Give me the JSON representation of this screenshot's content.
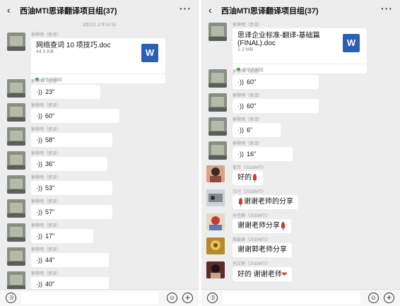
{
  "chat": {
    "title": "西油MTI思译翻译项目组(37)",
    "back_icon": "‹",
    "more_icon": "···"
  },
  "left": {
    "timestamp": "3月2日 上午10:15",
    "file": {
      "sender": "郭舜明（思译）",
      "name": "网络查词 10 项技巧.doc",
      "size": "44.5 KB",
      "icon_label": "W",
      "source": "微信电脑版"
    },
    "voices": [
      {
        "sender": "郭舜明（思译）",
        "duration": "23\""
      },
      {
        "sender": "郭舜明（思译）",
        "duration": "60\""
      },
      {
        "sender": "郭舜明（思译）",
        "duration": "58\""
      },
      {
        "sender": "郭舜明（思译）",
        "duration": "36\""
      },
      {
        "sender": "郭舜明（思译）",
        "duration": "53\""
      },
      {
        "sender": "郭舜明（思译）",
        "duration": "57\""
      },
      {
        "sender": "郭舜明（思译）",
        "duration": "17\""
      },
      {
        "sender": "郭舜明（思译）",
        "duration": "44\""
      },
      {
        "sender": "郭舜明（思译）",
        "duration": "40\""
      }
    ]
  },
  "right": {
    "file": {
      "sender": "郭舜明（思译）",
      "name": "思译企业标准-翻译-基础篇(FINAL).doc",
      "size": "1.3 MB",
      "icon_label": "W",
      "source": "微信电脑版"
    },
    "voices": [
      {
        "sender": "郭舜明（思译）",
        "duration": "60\""
      },
      {
        "sender": "郭舜明（思译）",
        "duration": "60\""
      },
      {
        "sender": "郭舜明（思译）",
        "duration": "6\""
      },
      {
        "sender": "郭舜明（思译）",
        "duration": "16\""
      }
    ],
    "texts": [
      {
        "sender": "邹芳（2018MTI）",
        "text": "好的",
        "emoji": "rose"
      },
      {
        "sender": "汪兴（2018MTI）",
        "text": "谢谢老师的分享",
        "emoji": "rose-prefix"
      },
      {
        "sender": "孙佳醇（2018MTI）",
        "text": "谢谢老师分享",
        "emoji": "rose"
      },
      {
        "sender": "周最颖（2018MTI）",
        "text": "谢谢郭老师分享",
        "emoji": ""
      },
      {
        "sender": "孙文婷（2018MTI）",
        "text": "好的 谢谢老师",
        "emoji": "heart"
      }
    ]
  },
  "input": {
    "voice_icon": "voice-toggle-icon",
    "emoji_icon": "emoji-icon",
    "plus_icon": "plus-icon"
  },
  "colors": {
    "chat_bg": "#ededed",
    "bubble_bg": "#ffffff",
    "word_icon": "#2b5fb3"
  }
}
